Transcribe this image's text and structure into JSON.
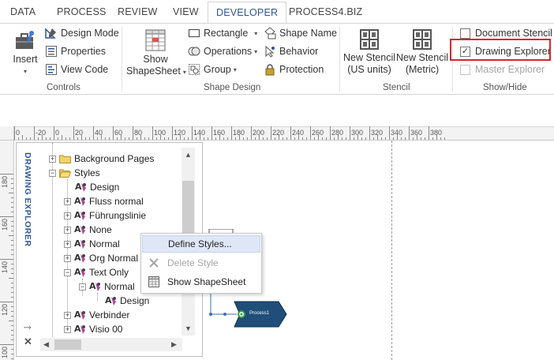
{
  "tabs": [
    {
      "label": "DATA"
    },
    {
      "label": "PROCESS"
    },
    {
      "label": "REVIEW"
    },
    {
      "label": "VIEW"
    },
    {
      "label": "DEVELOPER"
    },
    {
      "label": "PROCESS4.BIZ"
    }
  ],
  "ribbon": {
    "controls": {
      "insert_label": "Insert",
      "design_mode": "Design Mode",
      "properties": "Properties",
      "view_code": "View Code",
      "group_label": "Controls"
    },
    "shape_design": {
      "show_shapesheet_line1": "Show",
      "show_shapesheet_line2": "ShapeSheet",
      "rectangle": "Rectangle",
      "operations": "Operations",
      "group": "Group",
      "shape_name": "Shape Name",
      "behavior": "Behavior",
      "protection": "Protection",
      "group_label": "Shape Design"
    },
    "stencil": {
      "new_us_line1": "New Stencil",
      "new_us_line2": "(US units)",
      "new_metric_line1": "New Stencil",
      "new_metric_line2": "(Metric)",
      "group_label": "Stencil"
    },
    "show_hide": {
      "document_stencil": "Document Stencil",
      "drawing_explorer": "Drawing Explorer",
      "master_explorer": "Master Explorer",
      "group_label": "Show/Hide",
      "drawing_explorer_checked": true,
      "document_stencil_checked": false,
      "master_explorer_checked": false
    }
  },
  "ruler": {
    "h_labels": [
      "0",
      "-20",
      "0",
      "20",
      "40",
      "60",
      "80",
      "100",
      "120",
      "140",
      "160",
      "180",
      "200",
      "220",
      "240",
      "260",
      "280",
      "300",
      "320",
      "340",
      "360",
      "380"
    ],
    "v_labels": [
      "180",
      "160",
      "140",
      "120",
      "100"
    ]
  },
  "explorer": {
    "title": "DRAWING EXPLORER",
    "pin": "⤑",
    "close": "✕",
    "items": [
      {
        "label": "Background Pages",
        "kind": "folder"
      },
      {
        "label": "Styles",
        "kind": "folder"
      },
      {
        "label": "Design",
        "kind": "style"
      },
      {
        "label": "Fluss normal",
        "kind": "style"
      },
      {
        "label": "Führungslinie",
        "kind": "style"
      },
      {
        "label": "None",
        "kind": "style"
      },
      {
        "label": "Normal",
        "kind": "style"
      },
      {
        "label": "Org Normal",
        "kind": "style"
      },
      {
        "label": "Text Only",
        "kind": "style"
      },
      {
        "label": "Normal",
        "kind": "style"
      },
      {
        "label": "Design",
        "kind": "style"
      },
      {
        "label": "Verbinder",
        "kind": "style"
      },
      {
        "label": "Visio 00",
        "kind": "style"
      }
    ]
  },
  "context_menu": {
    "items": [
      {
        "label": "Define Styles..."
      },
      {
        "label": "Delete Style"
      },
      {
        "label": "Show ShapeSheet"
      }
    ]
  },
  "shape": {
    "label": "Process1",
    "color": "#1f4e79"
  },
  "colors": {
    "accent": "#2b579a",
    "highlight": "#d9252c"
  }
}
